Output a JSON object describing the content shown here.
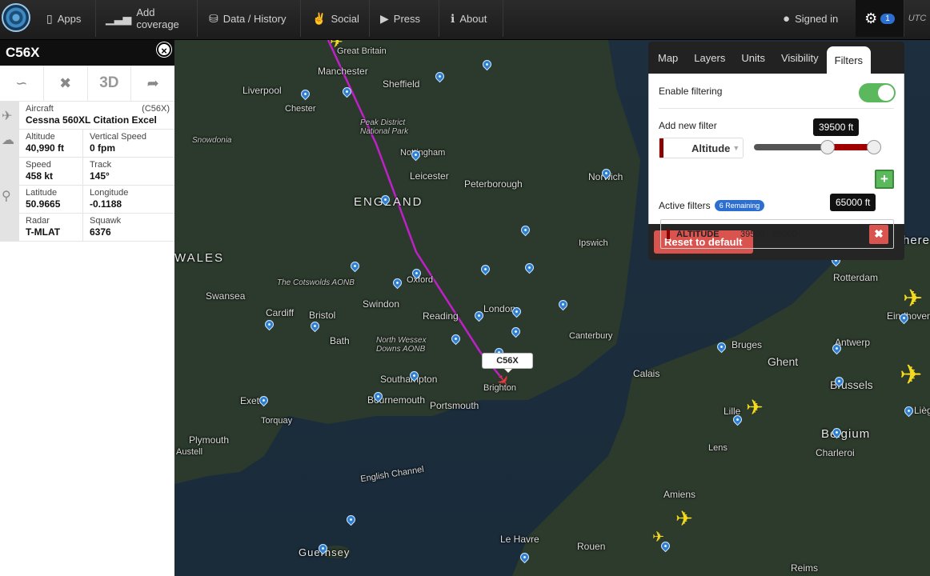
{
  "nav": {
    "items": [
      {
        "label": "Apps",
        "icon": "phone-icon"
      },
      {
        "label": "Add coverage",
        "icon": "signal-bars-icon"
      },
      {
        "label": "Data / History",
        "icon": "database-icon"
      },
      {
        "label": "Social",
        "icon": "thumbs-up-icon"
      },
      {
        "label": "Press",
        "icon": "megaphone-icon"
      },
      {
        "label": "About",
        "icon": "info-icon"
      }
    ],
    "signed_in": "Signed in",
    "settings_count": "1",
    "utc": "UTC"
  },
  "flight": {
    "callsign": "C56X",
    "aircraft_label": "Aircraft",
    "aircraft_code": "(C56X)",
    "aircraft_name": "Cessna 560XL Citation Excel",
    "altitude_label": "Altitude",
    "altitude": "40,990 ft",
    "vspeed_label": "Vertical Speed",
    "vspeed": "0 fpm",
    "speed_label": "Speed",
    "speed": "458 kt",
    "track_label": "Track",
    "track": "145°",
    "lat_label": "Latitude",
    "lat": "50.9665",
    "lon_label": "Longitude",
    "lon": "-0.1188",
    "radar_label": "Radar",
    "radar": "T-MLAT",
    "squawk_label": "Squawk",
    "squawk": "6376",
    "tool_3d": "3D"
  },
  "settings": {
    "tabs": [
      "Map",
      "Layers",
      "Units",
      "Visibility",
      "Filters"
    ],
    "enable_label": "Enable filtering",
    "add_label": "Add new filter",
    "filter_type": "Altitude",
    "slider_min_label": "39500 ft",
    "slider_max_label": "65000 ft",
    "slider_min_fraction": 0.61,
    "slider_max_fraction": 1.0,
    "active_label": "Active filters",
    "remaining": "6 Remaining",
    "active_filter_name": "ALTITUDE",
    "active_filter_range": "39500 - 65000",
    "reset_label": "Reset to default"
  },
  "map": {
    "callout": "C56X",
    "places": {
      "great_britain": "Great Britain",
      "manchester": "Manchester",
      "liverpool": "Liverpool",
      "sheffield": "Sheffield",
      "chester": "Chester",
      "peak": "Peak District\nNational Park",
      "snowdonia": "Snowdonia",
      "nottingham": "Nottingham",
      "leicester": "Leicester",
      "peterborough": "Peterborough",
      "norwich": "Norwich",
      "england": "ENGLAND",
      "wales": "WALES",
      "ipswich": "Ipswich",
      "cotswolds": "The Cotswolds AONB",
      "oxford": "Oxford",
      "swansea": "Swansea",
      "swindon": "Swindon",
      "london": "London",
      "cardiff": "Cardiff",
      "bristol": "Bristol",
      "reading": "Reading",
      "canterbury": "Canterbury",
      "bath": "Bath",
      "north_wessex": "North Wessex\nDowns AONB",
      "southampton": "Southampton",
      "brighton": "Brighton",
      "exeter": "Exeter",
      "bournemouth": "Bournemouth",
      "portsmouth": "Portsmouth",
      "calais": "Calais",
      "bruges": "Bruges",
      "ghent": "Ghent",
      "antwerp": "Antwerp",
      "rotterdam": "Rotterdam",
      "eindhoven": "Eindhoven",
      "brussels": "Brussels",
      "belgium": "Belgium",
      "lille": "Lille",
      "charleroi": "Charleroi",
      "lens": "Lens",
      "torquay": "Torquay",
      "plymouth": "Plymouth",
      "austell": "Austell",
      "english_channel": "English Channel",
      "amiens": "Amiens",
      "guernsey": "Guernsey",
      "le_havre": "Le Havre",
      "rouen": "Rouen",
      "reims": "Reims",
      "liege": "Liège",
      "here": "here"
    }
  },
  "colors": {
    "track": "#c020c8",
    "aircraft": "#f2dc1b",
    "pin": "#2f7fd0",
    "toggle_on": "#5cb85c",
    "danger": "#d9534f",
    "filter_bar": "#8b0000"
  }
}
